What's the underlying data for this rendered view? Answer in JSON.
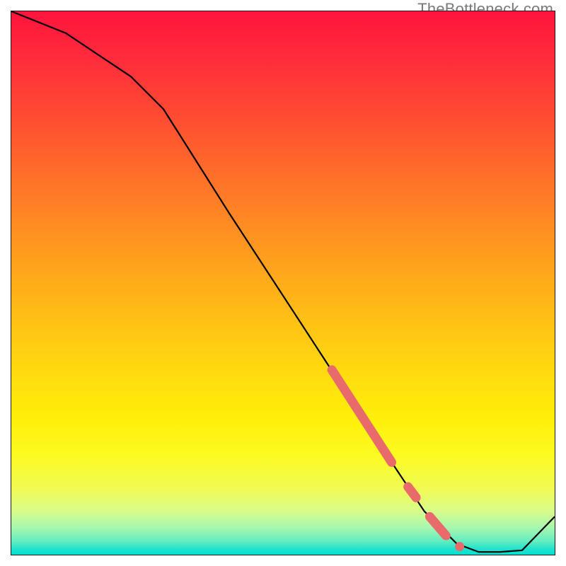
{
  "watermark": "TheBottleneck.com",
  "chart_data": {
    "type": "line",
    "title": "",
    "xlabel": "",
    "ylabel": "",
    "xlim": [
      0,
      100
    ],
    "ylim": [
      0,
      100
    ],
    "background": "red-yellow-green vertical gradient (bottleneck heatmap)",
    "series": [
      {
        "name": "bottleneck-curve",
        "color": "#000000",
        "x": [
          0,
          10,
          22,
          28,
          40,
          55,
          68,
          76,
          82,
          86,
          90,
          94,
          100
        ],
        "values": [
          100,
          96,
          88,
          82,
          63,
          40,
          20,
          8,
          2,
          0.5,
          0.5,
          0.8,
          7
        ]
      },
      {
        "name": "highlight-segments",
        "color": "#e86a6a",
        "type": "thick-overlay",
        "segments": [
          {
            "x": [
              59,
              70
            ],
            "values": [
              34,
              17
            ]
          },
          {
            "x": [
              73,
              74.5
            ],
            "values": [
              12.5,
              10.5
            ]
          },
          {
            "x": [
              77,
              80
            ],
            "values": [
              7,
              3.5
            ]
          }
        ],
        "dots": [
          {
            "x": 82.5,
            "value": 1.5
          }
        ]
      }
    ]
  }
}
